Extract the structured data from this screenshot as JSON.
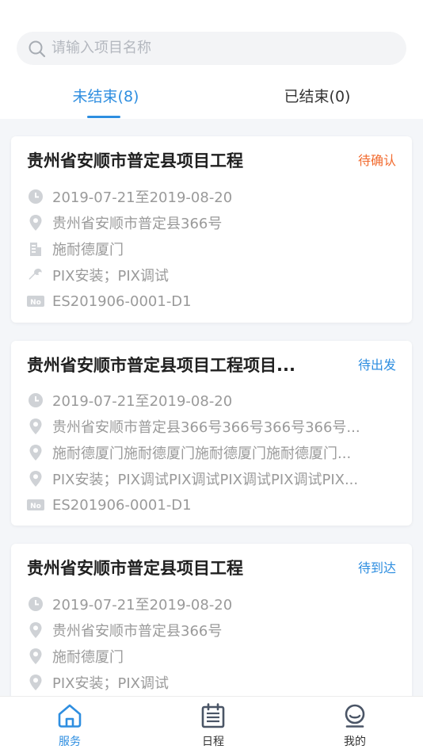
{
  "search": {
    "placeholder": "请输入项目名称"
  },
  "tabs": [
    {
      "label": "未结束(8)",
      "active": true
    },
    {
      "label": "已结束(0)",
      "active": false
    }
  ],
  "cards": [
    {
      "title": "贵州省安顺市普定县项目工程",
      "status": "待确认",
      "status_color": "#f26b2f",
      "date": "2019-07-21至2019-08-20",
      "address": "贵州省安顺市普定县366号",
      "company": "施耐德厦门",
      "service": "PIX安装；PIX调试",
      "number": "ES201906-0001-D1"
    },
    {
      "title": "贵州省安顺市普定县项目工程项目...",
      "status": "待出发",
      "status_color": "#2e8ee0",
      "date": "2019-07-21至2019-08-20",
      "address": "贵州省安顺市普定县366号366号366号366号...",
      "company": "施耐德厦门施耐德厦门施耐德厦门施耐德厦门...",
      "service": "PIX安装；PIX调试PIX调试PIX调试PIX调试PIX...",
      "number": "ES201906-0001-D1"
    },
    {
      "title": "贵州省安顺市普定县项目工程",
      "status": "待到达",
      "status_color": "#2e8ee0",
      "date": "2019-07-21至2019-08-20",
      "address": "贵州省安顺市普定县366号",
      "company": "施耐德厦门",
      "service": "PIX安装；PIX调试"
    }
  ],
  "nav": [
    {
      "label": "服务",
      "icon": "home-icon",
      "active": true
    },
    {
      "label": "日程",
      "icon": "calendar-icon",
      "active": false
    },
    {
      "label": "我的",
      "icon": "user-icon",
      "active": false
    }
  ],
  "colors": {
    "accent": "#2e8ee0",
    "pending_confirm": "#f26b2f",
    "muted_text": "#9a9a9a",
    "icon_gray": "#cfd2d6"
  }
}
